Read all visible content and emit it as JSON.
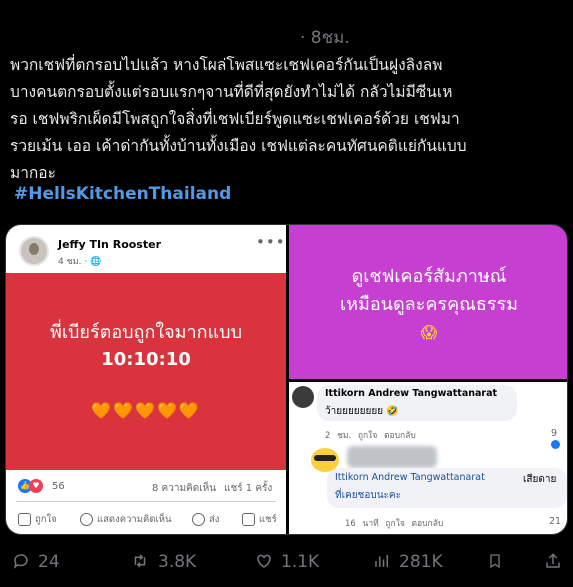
{
  "tweet": {
    "timestamp": "· 8ชม.",
    "text": "พวกเชฟที่ตกรอบไปแล้ว หางโผล่โพสแซะเชฟเคอร์กันเป็นฝูงลิงลพ\nบางคนตกรอบตั้งแต่รอบแรกๆจานที่ดีที่สุดยังทำไม่ได้ กลัวไม่มีซีนเห\nรอ เชฟพริกเผ็ดมีโพสถูกใจสิ่งที่เชฟเบียร์พูดแซะเชฟเคอร์ด้วย เชฟมา\nรวยเม้น เออ เค้าด่ากันทั้งบ้านทั้งเมือง เชฟแต่ละคนทัศนคติแย่กันแบบ\nมากอะ",
    "hashtag": "#HellsKitchenThailand"
  },
  "fb_post": {
    "author": "Jeffy TIn Rooster",
    "time": "4 ชม. · 🌐",
    "line1": "พี่เบียร์ตอบถูกใจมากแบบ",
    "line2": "10:10:10",
    "hearts": "🧡🧡🧡🧡🧡",
    "reaction_count": "56",
    "comments": "8 ความคิดเห็น",
    "shares": "แชร์ 1 ครั้ง",
    "actions": {
      "like": "ถูกใจ",
      "comment": "แสดงความคิดเห็น",
      "send": "ส่ง",
      "share": "แชร์"
    }
  },
  "purple_post": {
    "line1": "ดูเชฟเคอร์สัมภาษณ์",
    "line2": "เหมือนดูละครคุณธรรม",
    "emoji": "😱"
  },
  "comments": [
    {
      "name": "Ittikorn Andrew Tangwattanarat",
      "text": "ว้ายยยยยยยย 🤣",
      "meta": "2 ชม. ถูกใจ ตอบกลับ",
      "count": "9"
    },
    {
      "name": "Ittikorn Andrew Tangwattanarat",
      "text_prefix": "เสียดาย",
      "text": "ที่เคยชอบนะคะ",
      "meta": "16 นาที ถูกใจ ตอบกลับ",
      "count": "21"
    }
  ],
  "action_bar": {
    "replies": "24",
    "reposts": "3.8K",
    "likes": "1.1K",
    "views": "281K"
  },
  "colors": {
    "link": "#4f9be8",
    "fb_red": "#d9343e",
    "purple": "#c63fd0"
  }
}
